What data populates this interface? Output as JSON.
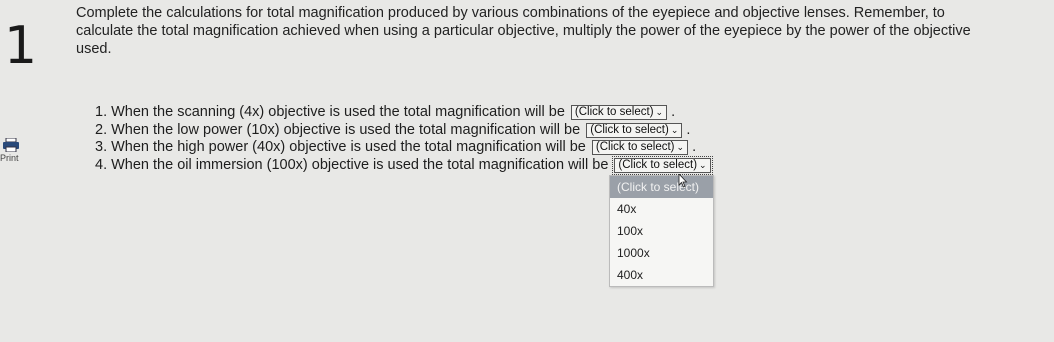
{
  "question": {
    "number": "1",
    "instructions": "Complete the calculations for total magnification produced by various combinations of the eyepiece and objective lenses. Remember, to calculate the total magnification achieved when using a particular objective, multiply the power of the eyepiece by the power of the objective used."
  },
  "sidebar": {
    "print_label": "Print",
    "print_icon": "printer-icon"
  },
  "items": [
    {
      "text": "1. When the scanning (4x) objective is used the total magnification will be",
      "select": "(Click to select)",
      "suffix": "."
    },
    {
      "text": "2. When the low power (10x) objective is used the total magnification will be",
      "select": "(Click to select)",
      "suffix": "."
    },
    {
      "text": "3. When the high power (40x) objective is used the total magnification will be",
      "select": "(Click to select)",
      "suffix": "."
    },
    {
      "text": "4. When the oil immersion (100x) objective is used the total magnification will be",
      "select": "(Click to select)",
      "suffix": ""
    }
  ],
  "dropdown": {
    "options": [
      "(Click to select)",
      "40x",
      "100x",
      "1000x",
      "400x"
    ],
    "highlighted_index": 0
  }
}
